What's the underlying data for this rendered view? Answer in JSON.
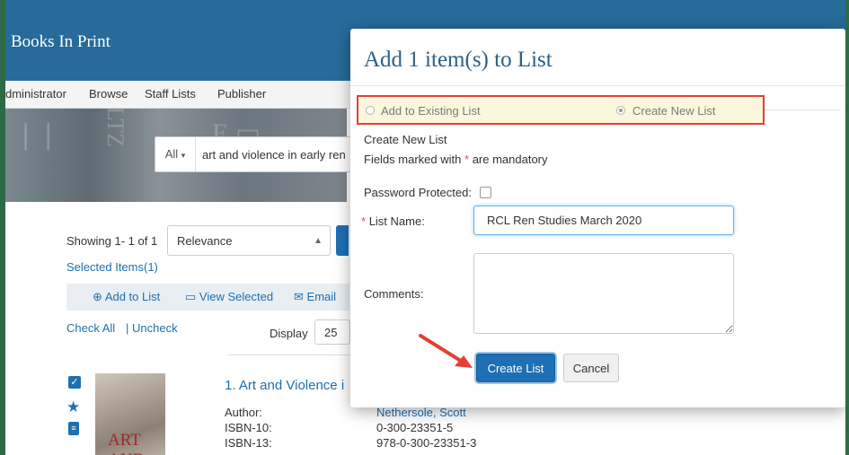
{
  "app": {
    "title": "Books In Print"
  },
  "nav": {
    "items": [
      "dministrator",
      "Browse",
      "Staff Lists",
      "Publisher"
    ]
  },
  "search": {
    "scope": "All",
    "query": "art and violence in early ren"
  },
  "results": {
    "showing": "Showing 1- 1 of 1",
    "sort_value": "Relevance",
    "selected_items": "Selected Items(1)",
    "actions": {
      "add_to_list": "Add to List",
      "view_selected": "View Selected",
      "email": "Email"
    },
    "check_all": "Check All",
    "uncheck": "Uncheck",
    "display_label": "Display",
    "display_value": "25",
    "item": {
      "title": "1. Art and Violence i",
      "author_label": "Author:",
      "author": "Nethersole, Scott",
      "isbn10_label": "ISBN-10:",
      "isbn10": "0-300-23351-5",
      "isbn13_label": "ISBN-13:",
      "isbn13": "978-0-300-23351-3",
      "cover_text": "ART AND"
    }
  },
  "modal": {
    "title": "Add 1 item(s) to List",
    "option_existing": "Add to Existing List",
    "option_new": "Create New List",
    "section_title": "Create New List",
    "mandatory_prefix": "Fields marked with",
    "mandatory_star": "*",
    "mandatory_suffix": "are mandatory",
    "password_label": "Password Protected:",
    "list_name_star": "*",
    "list_name_label": "List Name:",
    "list_name_value": "RCL Ren Studies March 2020",
    "comments_label": "Comments:",
    "comments_value": "",
    "create_button": "Create List",
    "cancel_button": "Cancel"
  },
  "colors": {
    "header": "#266b9a",
    "accent": "#1e6fb3",
    "highlight_border": "#e24033",
    "frame": "#2d6a45"
  }
}
